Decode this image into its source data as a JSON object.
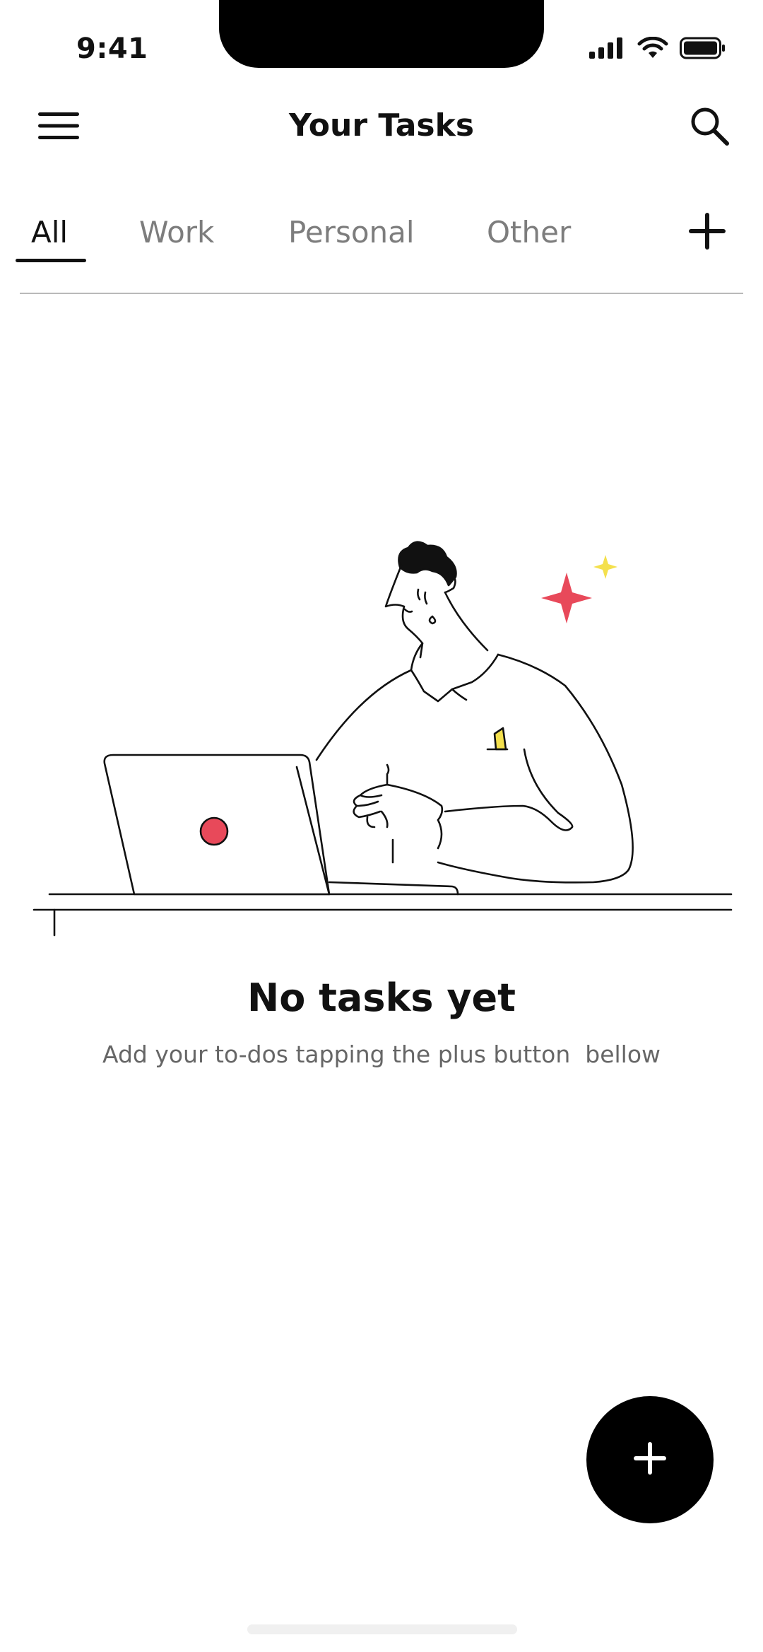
{
  "status_bar": {
    "time": "9:41",
    "signal_icon": "cellular-signal-icon",
    "wifi_icon": "wifi-icon",
    "battery_icon": "battery-icon"
  },
  "header": {
    "menu_icon": "hamburger-menu-icon",
    "title": "Your Tasks",
    "search_icon": "search-icon"
  },
  "tabs": {
    "items": [
      {
        "label": "All",
        "active": true
      },
      {
        "label": "Work",
        "active": false
      },
      {
        "label": "Personal",
        "active": false
      },
      {
        "label": "Other",
        "active": false
      }
    ],
    "add_icon": "plus-icon"
  },
  "empty_state": {
    "illustration": "person-at-laptop-illustration",
    "title": "No tasks yet",
    "subtitle": "Add your to-dos tapping the plus button  bellow"
  },
  "fab": {
    "icon": "plus-icon"
  },
  "colors": {
    "accent_red": "#e8495a",
    "accent_yellow": "#f4e04d",
    "text_primary": "#111111",
    "text_muted": "#7d7d7d",
    "divider": "#b9b9b9"
  }
}
